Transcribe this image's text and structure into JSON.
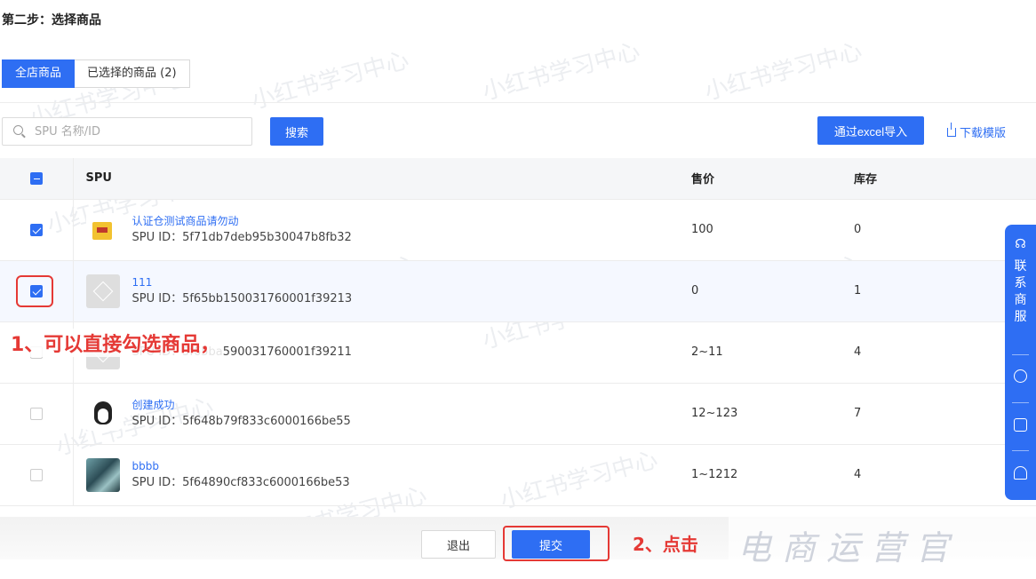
{
  "step_title": "第二步：选择商品",
  "tabs": [
    {
      "label": "全店商品",
      "active": true
    },
    {
      "label": "已选择的商品 (2)",
      "active": false
    }
  ],
  "search": {
    "placeholder": "SPU 名称/ID",
    "button": "搜索"
  },
  "import_button": "通过excel导入",
  "download_template": "下载模版",
  "table": {
    "headers": {
      "spu": "SPU",
      "price": "售价",
      "stock": "库存"
    },
    "rows": [
      {
        "name": "认证仓测试商品请勿动",
        "spu_id": "SPU ID：5f71db7deb95b30047b8fb32",
        "price": "100",
        "stock": "0",
        "checked": true,
        "thumb": "yellow-box-image"
      },
      {
        "name": "111",
        "spu_id": "SPU ID：5f65bb150031760001f39213",
        "price": "0",
        "stock": "1",
        "checked": true,
        "thumb": "placeholder-cube-image"
      },
      {
        "name": "",
        "spu_id": "SPU ID：5f65ba590031760001f39211",
        "price": "2~11",
        "stock": "4",
        "checked": false,
        "thumb": "placeholder-cube-image"
      },
      {
        "name": "创建成功",
        "spu_id": "SPU ID：5f648b79f833c6000166be55",
        "price": "12~123",
        "stock": "7",
        "checked": false,
        "thumb": "penguin-image"
      },
      {
        "name": "bbbb",
        "spu_id": "SPU ID：5f64890cf833c6000166be53",
        "price": "1~1212",
        "stock": "4",
        "checked": false,
        "thumb": "photo-image"
      }
    ]
  },
  "annotations": {
    "note1": "1、可以直接勾选商品，",
    "note2": "2、点击"
  },
  "footer": {
    "exit": "退出",
    "submit": "提交"
  },
  "watermark": "小红书学习中心",
  "brand_watermark": "电商运营官",
  "side_panel": {
    "contact_text": "联系商服"
  },
  "colors": {
    "primary": "#2e6ef3",
    "annotation_red": "#e53935"
  }
}
